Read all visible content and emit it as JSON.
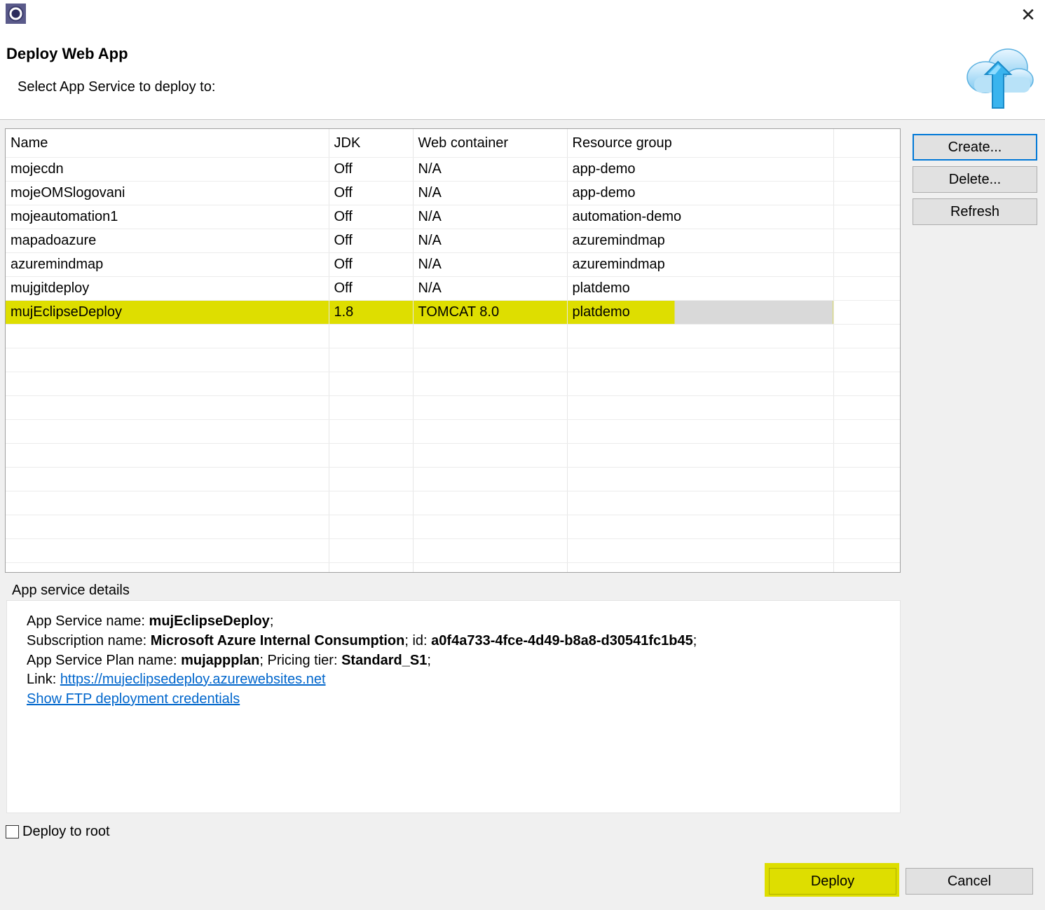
{
  "window": {
    "close_glyph": "✕"
  },
  "header": {
    "title": "Deploy Web App",
    "subtitle": "Select App Service to deploy to:"
  },
  "table": {
    "columns": [
      "Name",
      "JDK",
      "Web container",
      "Resource group"
    ],
    "rows": [
      [
        "mojecdn",
        "Off",
        "N/A",
        "app-demo"
      ],
      [
        "mojeOMSlogovani",
        "Off",
        "N/A",
        "app-demo"
      ],
      [
        "mojeautomation1",
        "Off",
        "N/A",
        "automation-demo"
      ],
      [
        "mapadoazure",
        "Off",
        "N/A",
        "azuremindmap"
      ],
      [
        "azuremindmap",
        "Off",
        "N/A",
        "azuremindmap"
      ],
      [
        "mujgitdeploy",
        "Off",
        "N/A",
        "platdemo"
      ],
      [
        "mujEclipseDeploy",
        "1.8",
        "TOMCAT 8.0",
        "platdemo"
      ]
    ],
    "selected_row": 6
  },
  "side_buttons": {
    "create": "Create...",
    "delete": "Delete...",
    "refresh": "Refresh"
  },
  "details": {
    "group_label": "App service details",
    "name_label": "App Service name: ",
    "name_value": "mujEclipseDeploy",
    "name_end": ";",
    "sub_label": "Subscription name: ",
    "sub_value": "Microsoft Azure Internal Consumption",
    "id_label": "; id: ",
    "id_value": "a0f4a733-4fce-4d49-b8a8-d30541fc1b45",
    "id_end": ";",
    "plan_label": "App Service Plan name: ",
    "plan_value": "mujappplan",
    "tier_label": "; Pricing tier: ",
    "tier_value": "Standard_S1",
    "tier_end": ";",
    "link_label": "Link: ",
    "link_url": "https://mujeclipsedeploy.azurewebsites.net",
    "ftp_link": "Show FTP deployment credentials"
  },
  "deploy_to_root": {
    "label": "Deploy to root",
    "checked": false
  },
  "footer": {
    "deploy": "Deploy",
    "cancel": "Cancel"
  },
  "colors": {
    "highlight": "#dede00",
    "link": "#0066cc",
    "focus_border": "#0078d7"
  }
}
